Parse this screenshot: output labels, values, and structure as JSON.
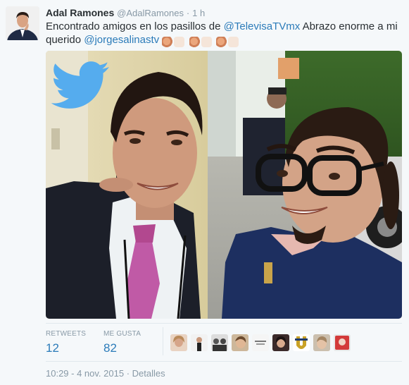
{
  "tweet": {
    "author_name": "Adal Ramones",
    "author_handle": "@AdalRamones",
    "separator": "·",
    "time_ago": "1 h",
    "text_before": "Encontrado amigos en los pasillos de ",
    "mention_1": "@TelevisaTVmx",
    "text_middle": " Abrazo enorme a mi querido ",
    "mention_2": "@jorgesalinastv",
    "emoji": [
      "clapping-hands",
      "clapping-hands",
      "clapping-hands"
    ]
  },
  "stats": {
    "retweets_label": "RETWEETS",
    "retweets_value": "12",
    "likes_label": "ME GUSTA",
    "likes_value": "82",
    "likers_count": 9
  },
  "footer": {
    "timestamp": "10:29 - 4 nov. 2015",
    "separator": "·",
    "details": "Detalles"
  },
  "colors": {
    "link": "#2b7bb9",
    "muted": "#8899a6",
    "twitter_blue": "#55acee",
    "background": "#f5f8fa"
  },
  "icons": {
    "photo_overlay": "twitter-bird-icon"
  }
}
